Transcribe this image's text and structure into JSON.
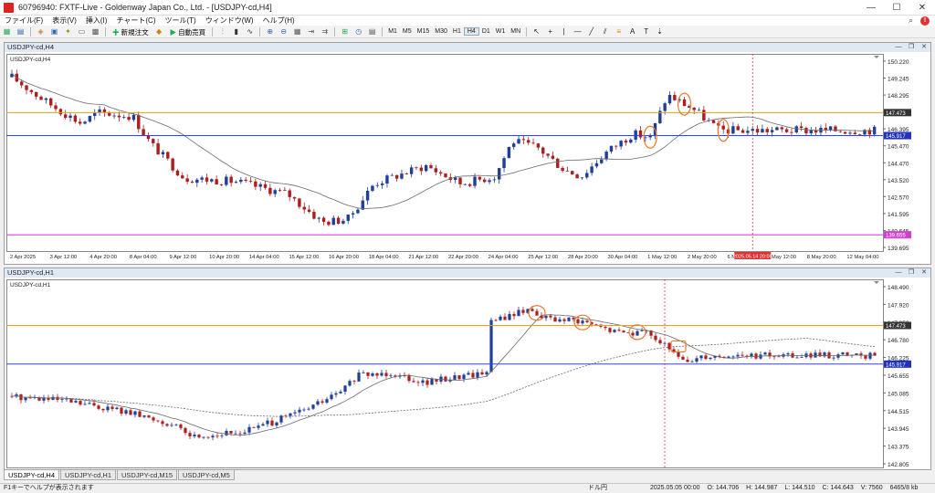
{
  "window": {
    "title": "60796940: FXTF-Live - Goldenway Japan Co., Ltd. - [USDJPY-cd,H4]",
    "minimize": "—",
    "maximize": "☐",
    "close": "✕"
  },
  "menu": {
    "items": [
      "ファイル(F)",
      "表示(V)",
      "挿入(I)",
      "チャート(C)",
      "ツール(T)",
      "ウィンドウ(W)",
      "ヘルプ(H)"
    ],
    "help_badge": "!"
  },
  "toolbar": {
    "new_order": "新規注文",
    "auto_trade": "自動売買",
    "timeframes": [
      "M1",
      "M5",
      "M15",
      "M30",
      "H1",
      "H4",
      "D1",
      "W1",
      "MN"
    ],
    "active_tf": "H4"
  },
  "chart_top": {
    "window_title": "USDJPY-cd,H4",
    "symbol_label": "USDJPY-cd,H4",
    "price_ticks": [
      "150.220",
      "149.245",
      "148.295",
      "147.345",
      "146.395",
      "145.470",
      "144.470",
      "143.520",
      "142.570",
      "141.595",
      "140.645",
      "139.695"
    ],
    "date_ticks": [
      "2 Apr 2025",
      "3 Apr 12:00",
      "4 Apr 20:00",
      "8 Apr 04:00",
      "9 Apr 12:00",
      "10 Apr 20:00",
      "14 Apr 04:00",
      "15 Apr 12:00",
      "16 Apr 20:00",
      "18 Apr 04:00",
      "21 Apr 12:00",
      "22 Apr 20:00",
      "24 Apr 04:00",
      "25 Apr 12:00",
      "28 Apr 20:00",
      "30 Apr 04:00",
      "1 May 12:00",
      "2 May 20:00",
      "6 May 04:00",
      "7 May 12:00",
      "8 May 20:00",
      "12 May 04:00"
    ],
    "price_labels": {
      "orange_line": "147.473",
      "blue_line": "145.917",
      "magenta_line": "139.655"
    },
    "cursor_time": "2025.05.14 20:00"
  },
  "chart_bottom": {
    "window_title": "USDJPY-cd,H1",
    "symbol_label": "USDJPY-cd,H1",
    "price_ticks": [
      "148.490",
      "147.920",
      "147.350",
      "146.780",
      "146.225",
      "145.655",
      "145.085",
      "144.515",
      "143.945",
      "143.375",
      "142.805"
    ],
    "price_labels": {
      "orange_line": "147.473",
      "blue_line": "145.917"
    }
  },
  "tabs": [
    "USDJPY-cd,H4",
    "USDJPY-cd,H1",
    "USDJPY-cd,M15",
    "USDJPY-cd,M5"
  ],
  "statusbar": {
    "help": "F1キーでヘルプが表示されます",
    "profile": "ドル円",
    "time": "2025.05.05 00:00",
    "open": "O: 144.706",
    "high": "H: 144.987",
    "low": "L: 144.510",
    "close": "C: 144.643",
    "volume": "V: 7560",
    "traffic": "6465/8 kb"
  },
  "colors": {
    "bull": "#1f3f99",
    "bear": "#ad1f1f",
    "ma": "#6a6a6a",
    "orange": "#e8a020",
    "blue": "#3344dd",
    "magenta": "#e040e0",
    "marker": "#e87a30"
  }
}
